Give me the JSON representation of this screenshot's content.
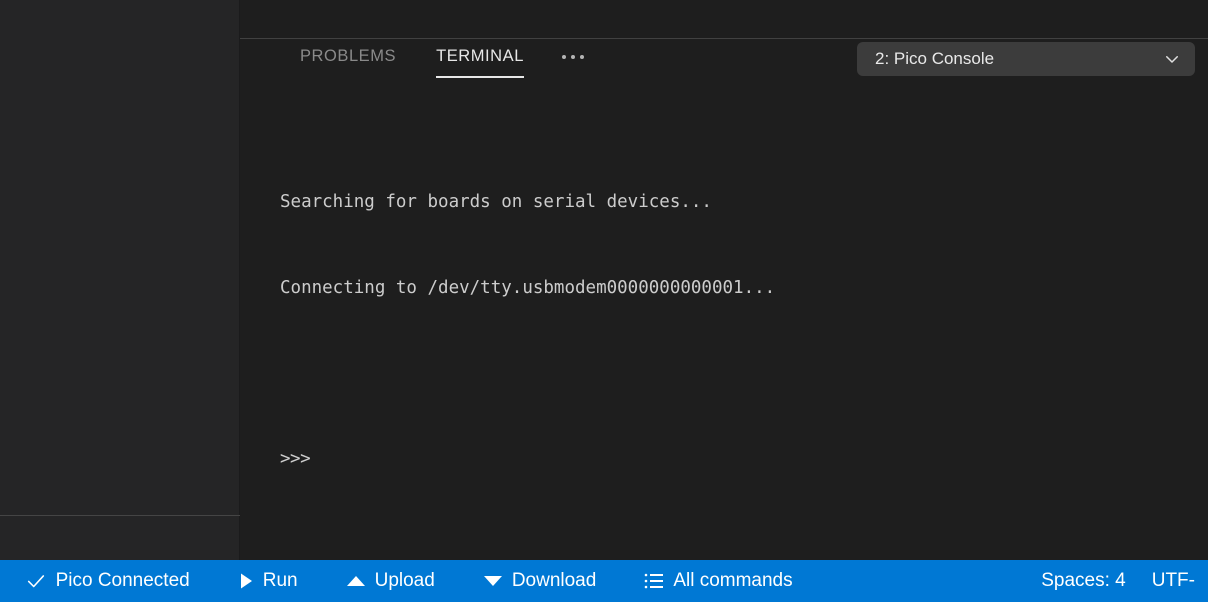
{
  "panel": {
    "tabs": [
      {
        "label": "PROBLEMS",
        "active": false
      },
      {
        "label": "TERMINAL",
        "active": true
      }
    ],
    "more_icon": "ellipsis-icon",
    "terminal_selector": {
      "value": "2: Pico Console",
      "chevron_icon": "chevron-down-icon"
    }
  },
  "terminal": {
    "lines": [
      "Searching for boards on serial devices...",
      "Connecting to /dev/tty.usbmodem0000000000001...",
      "",
      ">>>"
    ],
    "line1": "Searching for boards on serial devices...",
    "line2": "Connecting to /dev/tty.usbmodem0000000000001...",
    "prompt": ">>>"
  },
  "statusbar": {
    "truncated_left": "0",
    "items": [
      {
        "icon": "check-icon",
        "label": "Pico Connected"
      },
      {
        "icon": "play-icon",
        "label": "Run"
      },
      {
        "icon": "triangle-up-icon",
        "label": "Upload"
      },
      {
        "icon": "triangle-down-icon",
        "label": "Download"
      },
      {
        "icon": "list-icon",
        "label": "All commands"
      }
    ],
    "connected_label": "Pico Connected",
    "run_label": "Run",
    "upload_label": "Upload",
    "download_label": "Download",
    "all_commands_label": "All commands",
    "spaces_label": "Spaces: 4",
    "encoding_label": "UTF-"
  },
  "colors": {
    "accent_blue": "#0078d4",
    "panel_bg": "#1e1e1e",
    "sidebar_bg": "#252526",
    "select_bg": "#3c3c3c",
    "active_tab_text": "#e7e7e7",
    "inactive_tab_text": "#8a8a8a",
    "terminal_text": "#cccccc"
  }
}
